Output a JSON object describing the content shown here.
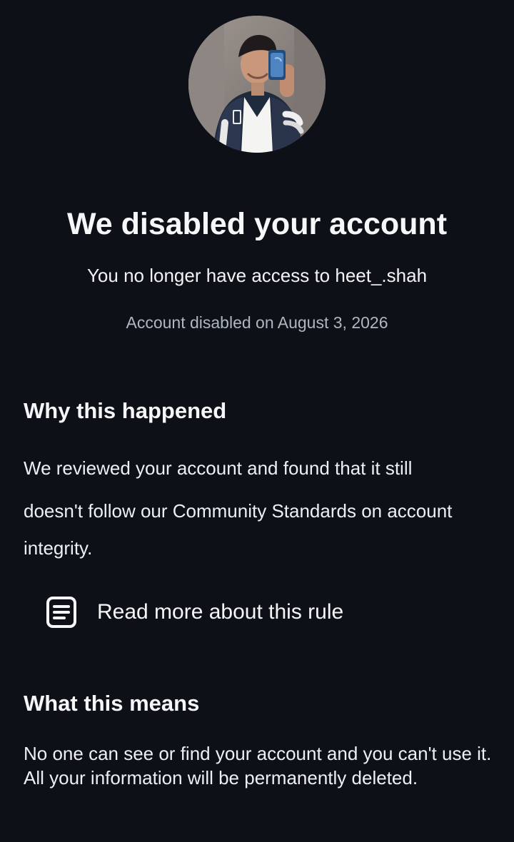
{
  "header": {
    "title": "We disabled your account",
    "subtitle": "You no longer have access to heet_.shah",
    "disabled_date": "Account disabled on August 3, 2026"
  },
  "why": {
    "heading": "Why this happened",
    "body_lines": [
      "We reviewed your account and found that it still",
      "doesn't follow our Community Standards on account",
      "integrity."
    ],
    "link_label": "Read more about this rule",
    "link_icon": "document-icon"
  },
  "means": {
    "heading": "What this means",
    "body": "No one can see or find your account and you can't use it. All your information will be permanently deleted."
  },
  "colors": {
    "background": "#0d1117",
    "text": "#f3f5f7",
    "muted_text": "#aeb6bf"
  }
}
